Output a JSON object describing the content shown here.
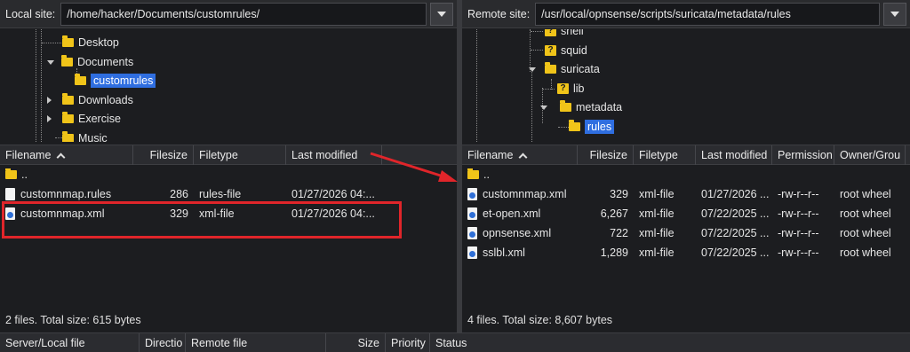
{
  "left": {
    "site_label": "Local site:",
    "path": "/home/hacker/Documents/customrules/",
    "tree": [
      {
        "label": "Desktop"
      },
      {
        "label": "Documents"
      },
      {
        "label": "customrules"
      },
      {
        "label": "Downloads"
      },
      {
        "label": "Exercise"
      },
      {
        "label": "Music"
      }
    ],
    "columns": [
      "Filename",
      "Filesize",
      "Filetype",
      "Last modified"
    ],
    "rows": [
      {
        "name": "..",
        "size": "",
        "type": "",
        "modified": "",
        "icon": "folder-icon"
      },
      {
        "name": "customnmap.rules",
        "size": "286",
        "type": "rules-file",
        "modified": "01/27/2026 04:...",
        "icon": "file-icon"
      },
      {
        "name": "customnmap.xml",
        "size": "329",
        "type": "xml-file",
        "modified": "01/27/2026 04:...",
        "icon": "xml-file-icon"
      }
    ],
    "status": "2 files. Total size: 615 bytes"
  },
  "right": {
    "site_label": "Remote site:",
    "path": "/usr/local/opnsense/scripts/suricata/metadata/rules",
    "tree": [
      {
        "label": "shell"
      },
      {
        "label": "squid"
      },
      {
        "label": "suricata"
      },
      {
        "label": "lib"
      },
      {
        "label": "metadata"
      },
      {
        "label": "rules"
      }
    ],
    "columns": [
      "Filename",
      "Filesize",
      "Filetype",
      "Last modified",
      "Permission",
      "Owner/Grou"
    ],
    "rows": [
      {
        "name": "..",
        "size": "",
        "type": "",
        "modified": "",
        "perm": "",
        "owner": "",
        "icon": "folder-icon"
      },
      {
        "name": "customnmap.xml",
        "size": "329",
        "type": "xml-file",
        "modified": "01/27/2026 ...",
        "perm": "-rw-r--r--",
        "owner": "root wheel",
        "icon": "xml-file-icon"
      },
      {
        "name": "et-open.xml",
        "size": "6,267",
        "type": "xml-file",
        "modified": "07/22/2025 ...",
        "perm": "-rw-r--r--",
        "owner": "root wheel",
        "icon": "xml-file-icon"
      },
      {
        "name": "opnsense.xml",
        "size": "722",
        "type": "xml-file",
        "modified": "07/22/2025 ...",
        "perm": "-rw-r--r--",
        "owner": "root wheel",
        "icon": "xml-file-icon"
      },
      {
        "name": "sslbl.xml",
        "size": "1,289",
        "type": "xml-file",
        "modified": "07/22/2025 ...",
        "perm": "-rw-r--r--",
        "owner": "root wheel",
        "icon": "xml-file-icon"
      }
    ],
    "status": "4 files. Total size: 8,607 bytes"
  },
  "queue": {
    "columns": [
      "Server/Local file",
      "Directio",
      "Remote file",
      "Size",
      "Priority",
      "Status"
    ]
  },
  "colors": {
    "annotation": "#e0252a",
    "selection": "#2f6ee0",
    "folder": "#f0c419"
  }
}
